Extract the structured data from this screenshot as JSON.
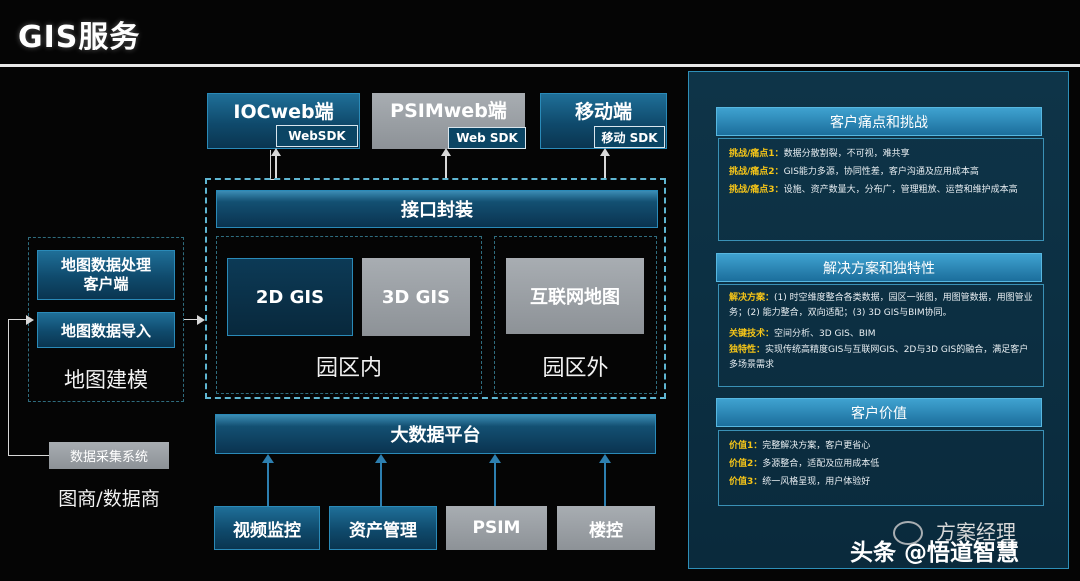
{
  "page": {
    "title": "GIS服务"
  },
  "clients": [
    {
      "name": "IOCweb端",
      "sdk": "WebSDK"
    },
    {
      "name": "PSIMweb端",
      "sdk": "Web SDK"
    },
    {
      "name": "移动端",
      "sdk": "移动 SDK"
    }
  ],
  "interface_layer": "接口封装",
  "inner_zone": {
    "label": "园区内",
    "items": [
      "2D GIS",
      "3D GIS"
    ]
  },
  "outer_zone": {
    "label": "园区外",
    "item": "互联网地图"
  },
  "bigdata": "大数据平台",
  "sources": [
    "视频监控",
    "资产管理",
    "PSIM",
    "楼控"
  ],
  "modeling": {
    "label": "地图建模",
    "items": [
      "地图数据处理\n客户端",
      "地图数据导入"
    ]
  },
  "collection": {
    "tag": "数据采集系统",
    "label": "图商/数据商"
  },
  "panel": {
    "sections": [
      {
        "title": "客户痛点和挑战",
        "lines": [
          {
            "key": "挑战/痛点1：",
            "text": "数据分散割裂，不可视，难共享"
          },
          {
            "key": "挑战/痛点2：",
            "text": "GIS能力多源，协同性差，客户沟通及应用成本高"
          },
          {
            "key": "挑战/痛点3：",
            "text": "设施、资产数量大，分布广，管理粗放、运营和维护成本高"
          }
        ]
      },
      {
        "title": "解决方案和独特性",
        "lines": [
          {
            "key": "解决方案：",
            "text": "(1) 时空维度整合各类数据，园区一张图，用图管数据，用图管业务；(2) 能力整合，双向适配；(3) 3D GIS与BIM协同。"
          },
          {
            "key": "关键技术：",
            "text": "空间分析、3D GIS、BIM"
          },
          {
            "key": "独特性：",
            "text": "实现传统高精度GIS与互联网GIS、2D与3D GIS的融合，满足客户多场景需求"
          }
        ]
      },
      {
        "title": "客户价值",
        "lines": [
          {
            "key": "价值1：",
            "text": "完整解决方案，客户更省心"
          },
          {
            "key": "价值2：",
            "text": "多源整合，适配及应用成本低"
          },
          {
            "key": "价值3：",
            "text": "统一风格呈现，用户体验好"
          }
        ]
      }
    ]
  },
  "watermark": {
    "line1": "方案经理",
    "line2": "头条 @悟道智慧"
  },
  "colors": {
    "accent_blue": "#1f6f98",
    "grey_box": "#a0a5aa",
    "highlight": "#f5c518"
  }
}
